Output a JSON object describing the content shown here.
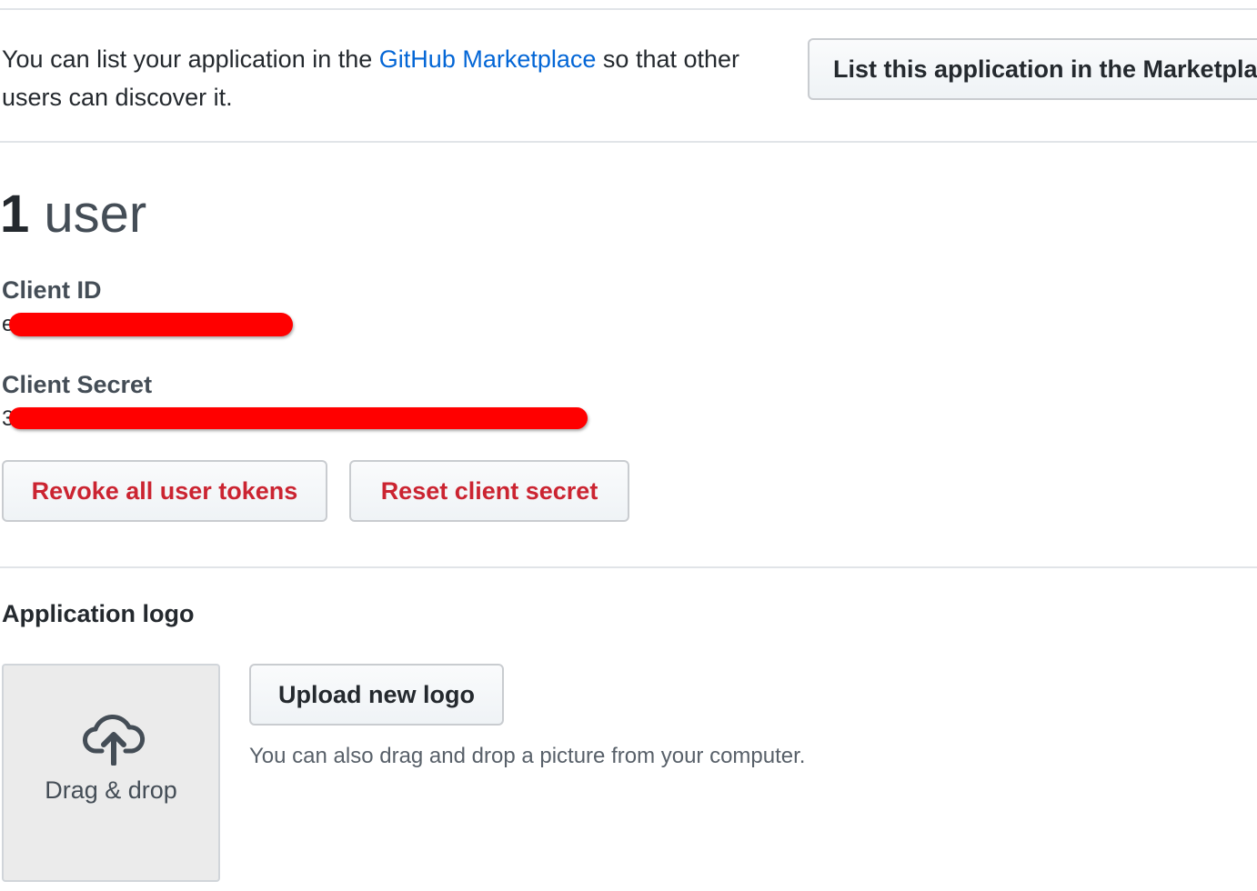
{
  "marketplace": {
    "text_before": "You can list your application in the",
    "link_text": "GitHub Marketplace",
    "text_after": "so that other users can discover it.",
    "button_label": "List this application in the Marketplace"
  },
  "users": {
    "count": "1",
    "unit": "user"
  },
  "credentials": {
    "client_id_label": "Client ID",
    "client_id_visible": "e",
    "client_secret_label": "Client Secret",
    "client_secret_visible": "3"
  },
  "actions": {
    "revoke_label": "Revoke all user tokens",
    "reset_label": "Reset client secret"
  },
  "logo": {
    "heading": "Application logo",
    "dropzone_label": "Drag & drop",
    "dropzone_icon": "cloud-upload-icon",
    "upload_button_label": "Upload new logo",
    "note": "You can also drag and drop a picture from your computer."
  },
  "colors": {
    "link": "#0366d6",
    "danger": "#cb2431",
    "redaction": "#ff0000"
  }
}
